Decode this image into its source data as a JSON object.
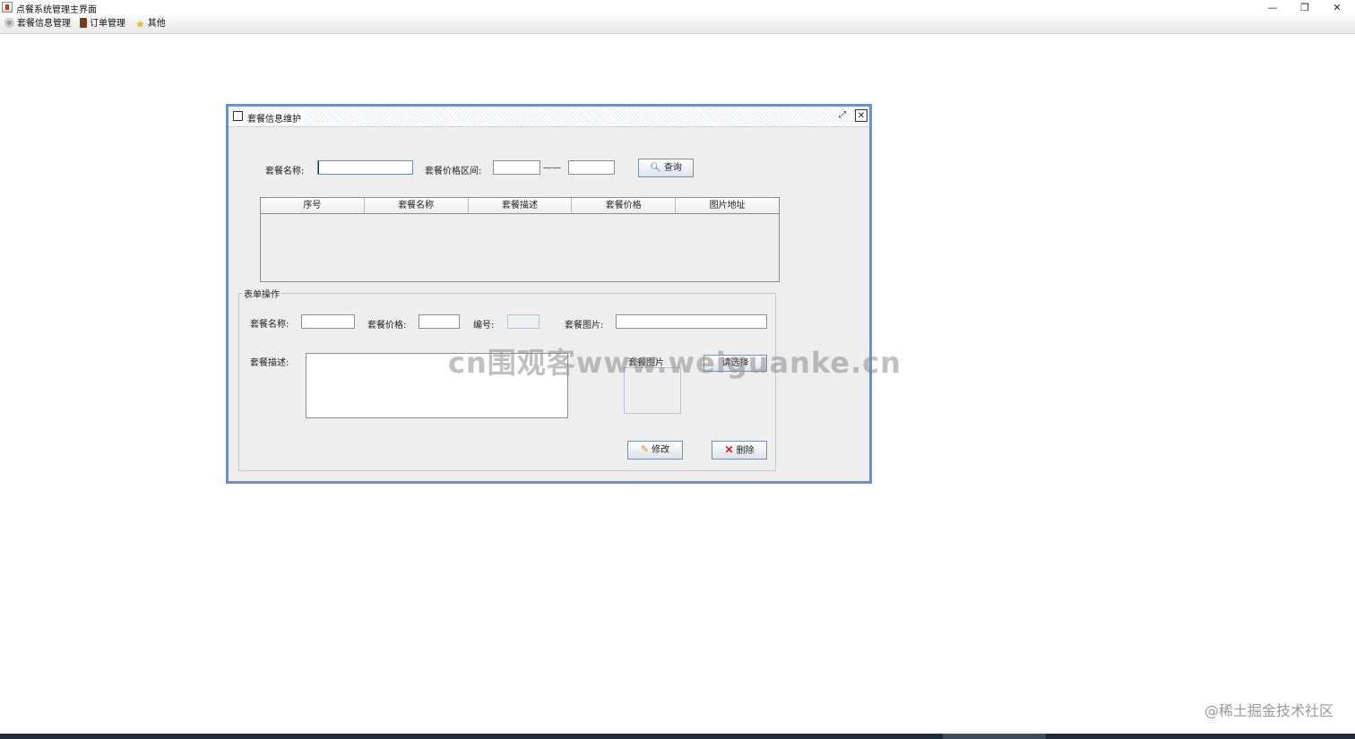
{
  "window": {
    "title": "点餐系统管理主界面",
    "controls": {
      "minimize": "—",
      "restore": "❐",
      "close": "✕"
    }
  },
  "menu": {
    "items": [
      {
        "label": "套餐信息管理",
        "icon": "gear-icon"
      },
      {
        "label": "订单管理",
        "icon": "book-icon"
      },
      {
        "label": "其他",
        "icon": "star-icon"
      }
    ]
  },
  "internal_frame": {
    "title": "套餐信息维护",
    "controls": {
      "maximize": "⤢",
      "close": "✕"
    },
    "search": {
      "name_label": "套餐名称:",
      "name_value": "",
      "price_range_label": "套餐价格区间:",
      "price_min_value": "",
      "range_separator": "——",
      "price_max_value": "",
      "search_button": "查询",
      "search_icon": "magnifier-icon"
    },
    "table": {
      "columns": [
        "序号",
        "套餐名称",
        "套餐描述",
        "套餐价格",
        "图片地址"
      ],
      "rows": []
    },
    "form": {
      "group_title": "表单操作",
      "name_label": "套餐名称:",
      "name_value": "",
      "price_label": "套餐价格:",
      "price_value": "",
      "id_label": "编号:",
      "id_value": "",
      "image_label": "套餐图片:",
      "image_value": "",
      "desc_label": "套餐描述:",
      "desc_value": "",
      "image_preview_label": "套餐图片",
      "clear_button": "请选择",
      "modify_button": "修改",
      "modify_icon": "pencil-icon",
      "delete_button": "删除",
      "delete_icon": "red-x-icon"
    }
  },
  "watermark": "cn围观客www.weiguanke.cn",
  "corner_watermark": "@稀土掘金技术社区",
  "colors": {
    "frame_border": "#6e8fc8",
    "panel_bg": "#eeeeee",
    "delete_icon": "#d41f1f"
  }
}
